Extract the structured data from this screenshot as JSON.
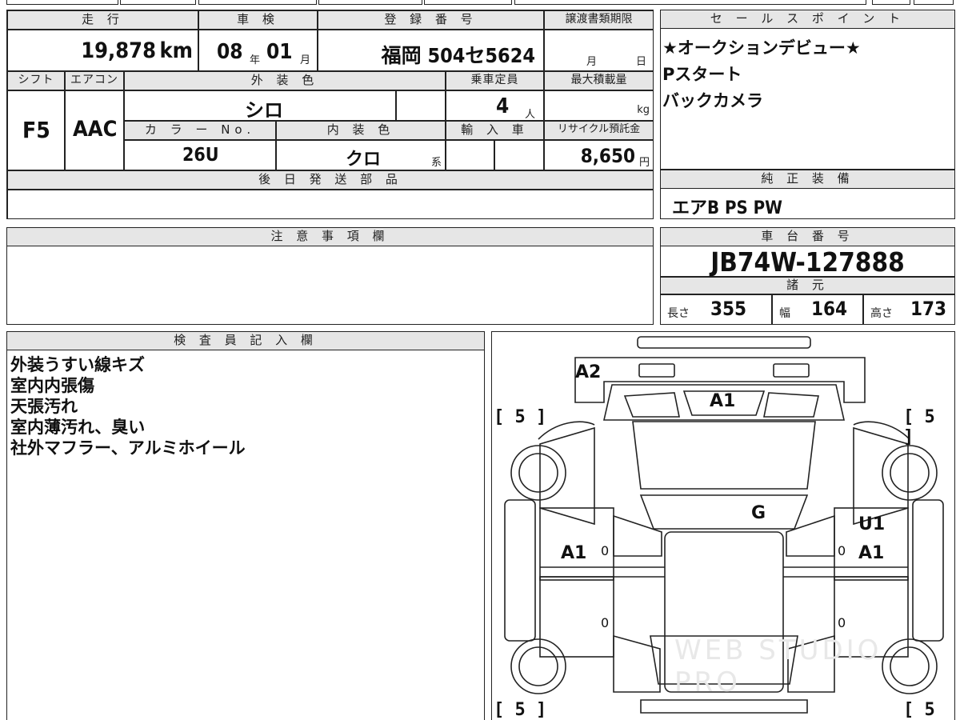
{
  "top_strip": {
    "partial_text": "■■■■"
  },
  "vehicle_info": {
    "mileage": {
      "label": "走 行",
      "value": "19,878",
      "unit": "km"
    },
    "inspection": {
      "label": "車 検",
      "year": "08",
      "year_unit": "年",
      "month": "01",
      "month_unit": "月"
    },
    "registration": {
      "label": "登 録 番 号",
      "value": "福岡 504セ5624"
    },
    "transfer_deadline": {
      "label": "譲渡書類期限",
      "month_unit": "月",
      "day_unit": "日"
    },
    "shift": {
      "label": "シフト",
      "value": "F5"
    },
    "aircon": {
      "label": "エアコン",
      "value": "AAC"
    },
    "exterior_color": {
      "label": "外 装 色",
      "value": "シロ"
    },
    "capacity": {
      "label": "乗車定員",
      "value": "4",
      "unit": "人"
    },
    "max_load": {
      "label": "最大積載量",
      "unit": "kg"
    },
    "color_no": {
      "label": "カ ラ ー No.",
      "value": "26U"
    },
    "interior_color": {
      "label": "内 装 色",
      "value": "クロ",
      "unit": "系"
    },
    "import": {
      "label": "輸 入 車"
    },
    "recycle_fee": {
      "label": "リサイクル預託金",
      "value": "8,650",
      "unit": "円"
    }
  },
  "later_parts": {
    "label": "後 日 発 送 部 品",
    "value": ""
  },
  "sales_points": {
    "label": "セ ー ル ス ポ イ ン ト",
    "lines": [
      "★オークションデビュー★",
      "Pスタート",
      "バックカメラ"
    ]
  },
  "genuine_equipment": {
    "label": "純 正 装 備",
    "value": "エアB PS PW"
  },
  "notes": {
    "label": "注 意 事 項 欄",
    "value": ""
  },
  "chassis": {
    "label": "車 台 番 号",
    "value": "JB74W-127888"
  },
  "specs": {
    "label": "諸 元",
    "length_label": "長さ",
    "length": "355",
    "width_label": "幅",
    "width": "164",
    "height_label": "高さ",
    "height": "173"
  },
  "inspector": {
    "label": "検 査 員 記 入 欄",
    "lines": [
      "外装うすい線キズ",
      "室内内張傷",
      "天張汚れ",
      "室内薄汚れ、臭い",
      "社外マフラー、アルミホイール"
    ]
  },
  "diagram": {
    "codes": {
      "rear_left_corner": "A2",
      "front_top": "A1",
      "windshield": "G",
      "right_upper": "U1",
      "right_door": "A1",
      "left_door": "A1"
    },
    "tire_tl": "[ 5 ]",
    "tire_tr": "[ 5 ]",
    "tire_bl": "[ 5 ]",
    "tire_br": "[ 5 ]",
    "zero_marks": [
      "0",
      "0",
      "0",
      "0"
    ],
    "watermark": "WEB STUDIO PRO"
  }
}
